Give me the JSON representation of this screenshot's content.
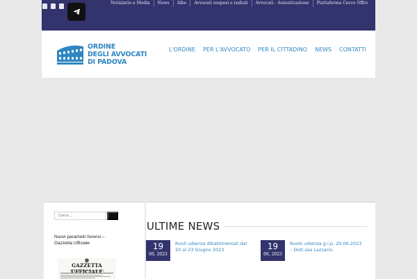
{
  "topbar": {
    "links": [
      "Notiziario e Media",
      "News",
      "Albo",
      "Avvocati sospesi e radiati",
      "Avvocati - Autenticazione",
      "Piattaforma Cerco Offro"
    ]
  },
  "header": {
    "logo_lines": [
      "ORDINE",
      "DEGLI AVVOCATI",
      "DI PADOVA"
    ],
    "nav": [
      "L'ORDINE",
      "PER L'AVVOCATO",
      "PER IL CITTADINO",
      "NEWS",
      "CONTATTI"
    ]
  },
  "sidebar": {
    "search_placeholder": "Cerca ...",
    "article_title": "Nuovi parametri forensi – Gazzetta Ufficiale",
    "gazzetta_title": "GAZZETTA UFFICIALE",
    "gazzetta_sub": "DELLA REPUBBLICA ITALIANA"
  },
  "news": {
    "title": "ULTIME NEWS",
    "items": [
      {
        "day": "19",
        "month": "06, 2023",
        "title": "Ruoli udienze dibattimentali dal 20 al 23 Giugno 2023"
      },
      {
        "day": "19",
        "month": "06, 2023",
        "title": "Ruolo udienza g.i.p. 20.06.2023 – Dott.ssa Lazzarin."
      }
    ]
  },
  "colors": {
    "topbar_bg": "#33336e",
    "accent_blue": "#2f86c2",
    "page_bg": "#e9e9e9"
  }
}
